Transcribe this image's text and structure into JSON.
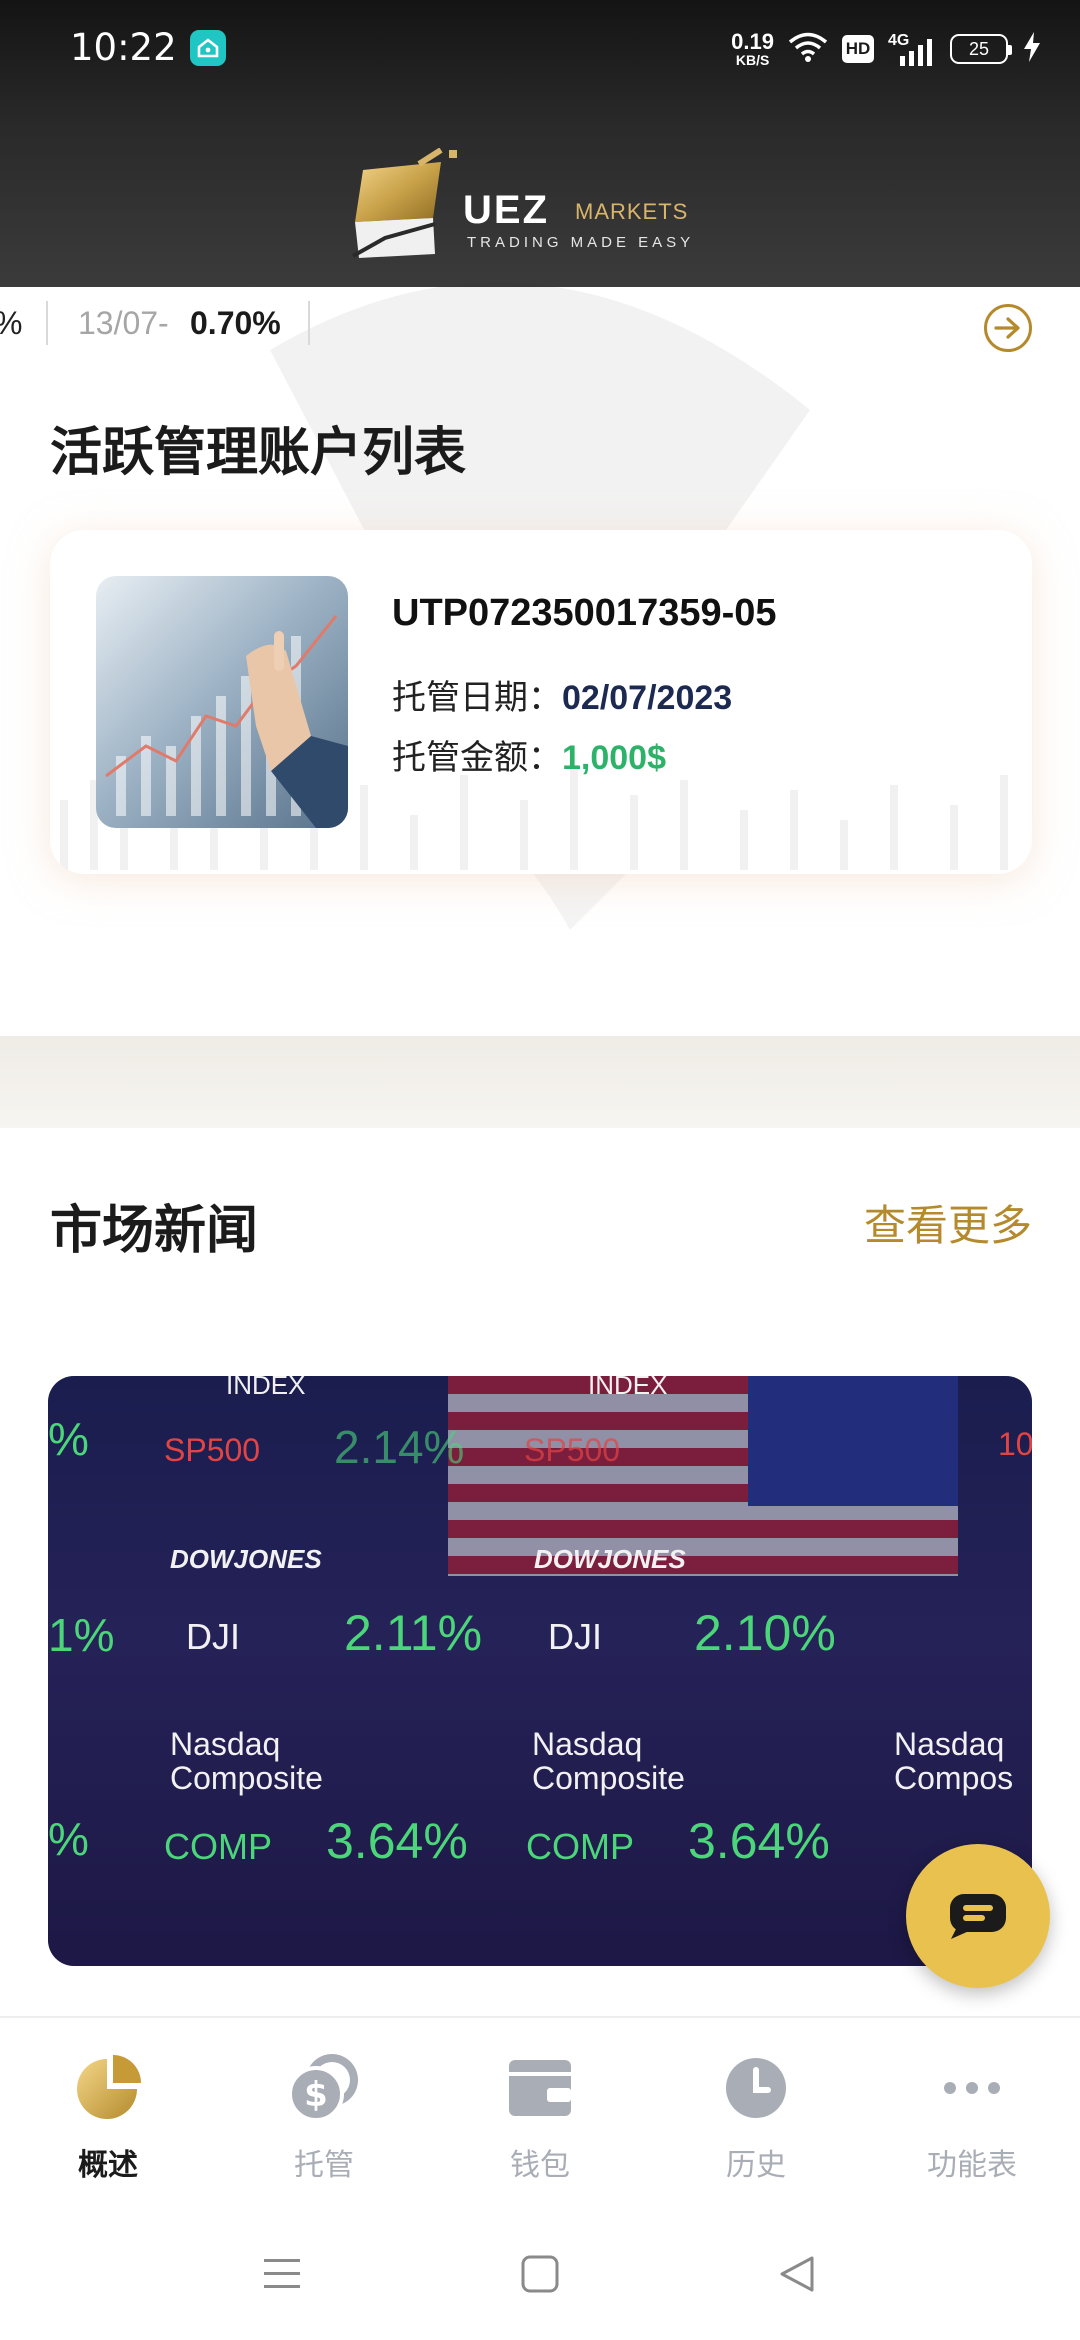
{
  "status_bar": {
    "time": "10:22",
    "speed_value": "0.19",
    "speed_unit": "KB/S",
    "hd": "HD",
    "network": "4G",
    "battery": "25"
  },
  "brand": {
    "name": "UEZ",
    "suffix": "MARKETS",
    "tagline": "TRADING MADE EASY",
    "accent_color": "#b48a2c"
  },
  "ticker": {
    "prev_fragment": "%",
    "date": "13/07",
    "dash": "-",
    "value": "0.70%"
  },
  "accounts_section": {
    "title": "活跃管理账户列表",
    "account": {
      "id": "UTP072350017359-05",
      "date_label": "托管日期：",
      "date_value": "02/07/2023",
      "amount_label": "托管金额：",
      "amount_value": "1,000$"
    }
  },
  "news_section": {
    "title": "市场新闻",
    "see_more": "查看更多",
    "image_text": {
      "index1": "INDEX",
      "index2": "INDEX",
      "sp500_1": "SP500",
      "sp500_2": "SP500",
      "sp_val": "2.14%",
      "dowjones_1": "DOWJONES",
      "dowjones_2": "DOWJONES",
      "dji_1": "DJI",
      "dji_2": "DJI",
      "dji_val_1": "2.11%",
      "dji_val_2": "2.10%",
      "nasdaq_1": "Nasdaq",
      "composite_1": "Composite",
      "nasdaq_2": "Nasdaq",
      "composite_2": "Composite",
      "nasdaq_3": "Nasdaq",
      "composite_3": "Compos",
      "comp_1": "COMP",
      "comp_2": "COMP",
      "comp_val_1": "3.64%",
      "comp_val_2": "3.64%",
      "left_pct_1": "%",
      "left_pct_2": "1%",
      "left_pct_3": "%",
      "right_10": "10"
    }
  },
  "bottom_nav": {
    "items": [
      {
        "label": "概述",
        "icon": "pie-chart-icon",
        "active": true
      },
      {
        "label": "托管",
        "icon": "coins-icon",
        "active": false
      },
      {
        "label": "钱包",
        "icon": "wallet-icon",
        "active": false
      },
      {
        "label": "历史",
        "icon": "clock-icon",
        "active": false
      },
      {
        "label": "功能表",
        "icon": "more-icon",
        "active": false
      }
    ]
  }
}
